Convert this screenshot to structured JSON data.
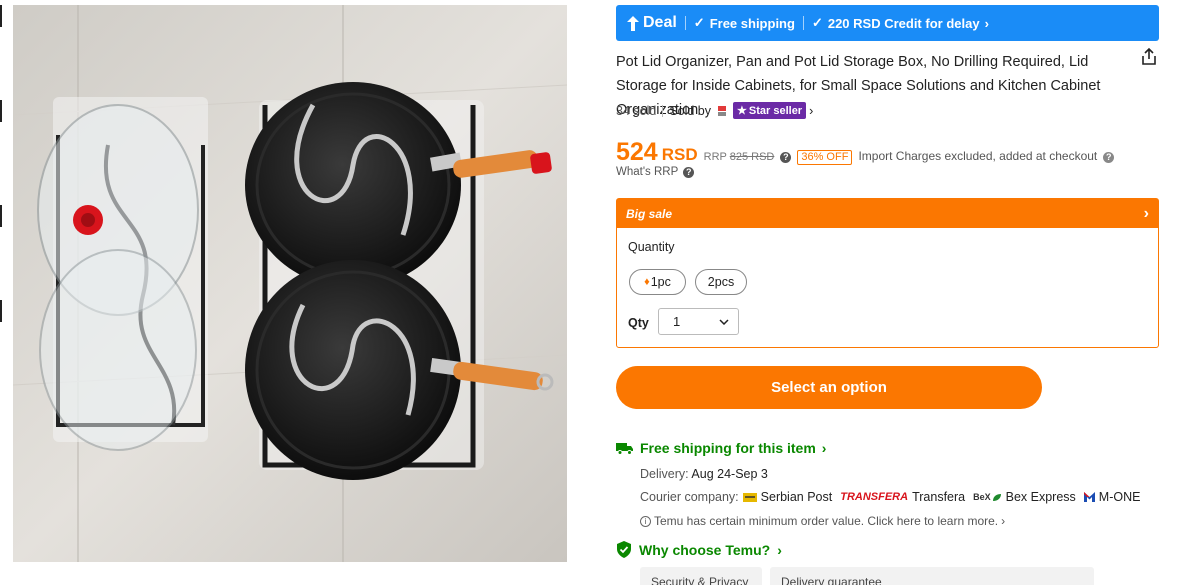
{
  "deal_bar": {
    "title": "Deal",
    "free_shipping": "Free shipping",
    "credit": "220 RSD Credit for delay",
    "bg_color": "#1a8cf7"
  },
  "product": {
    "title": "Pot Lid Organizer, Pan and Pot Lid Storage Box, No Drilling Required, Lid Storage for Inside Cabinets, for Small Space Solutions and Kitchen Cabinet Organization",
    "sold": "34 sold",
    "sold_by": "Sold by",
    "star_seller": "Star seller"
  },
  "price": {
    "value": "524",
    "currency": "RSD",
    "rrp_label": "RRP",
    "rrp_value": "825 RSD",
    "discount": "36% OFF",
    "import_note": "Import Charges excluded, added at checkout",
    "whats_rrp": "What's RRP",
    "color": "#fb7701"
  },
  "sale_box": {
    "title": "Big sale",
    "quantity_label": "Quantity",
    "options": [
      "1pc",
      "2pcs"
    ],
    "qty_label": "Qty",
    "qty_value": "1"
  },
  "cta": {
    "label": "Select an option"
  },
  "shipping": {
    "title": "Free shipping for this item",
    "delivery_label": "Delivery:",
    "delivery_value": "Aug 24-Sep 3",
    "courier_label": "Courier company:",
    "couriers": [
      "Serbian Post",
      "Transfera",
      "Bex Express",
      "M-ONE"
    ],
    "transfera_logo": "TRANSFERA",
    "bex_logo": "BeX",
    "min_order": "Temu has certain minimum order value. Click here to learn more.",
    "accent_color": "#0a8800"
  },
  "why": {
    "title": "Why choose Temu?",
    "tabs": [
      "Security & Privacy",
      "Delivery guarantee"
    ]
  }
}
